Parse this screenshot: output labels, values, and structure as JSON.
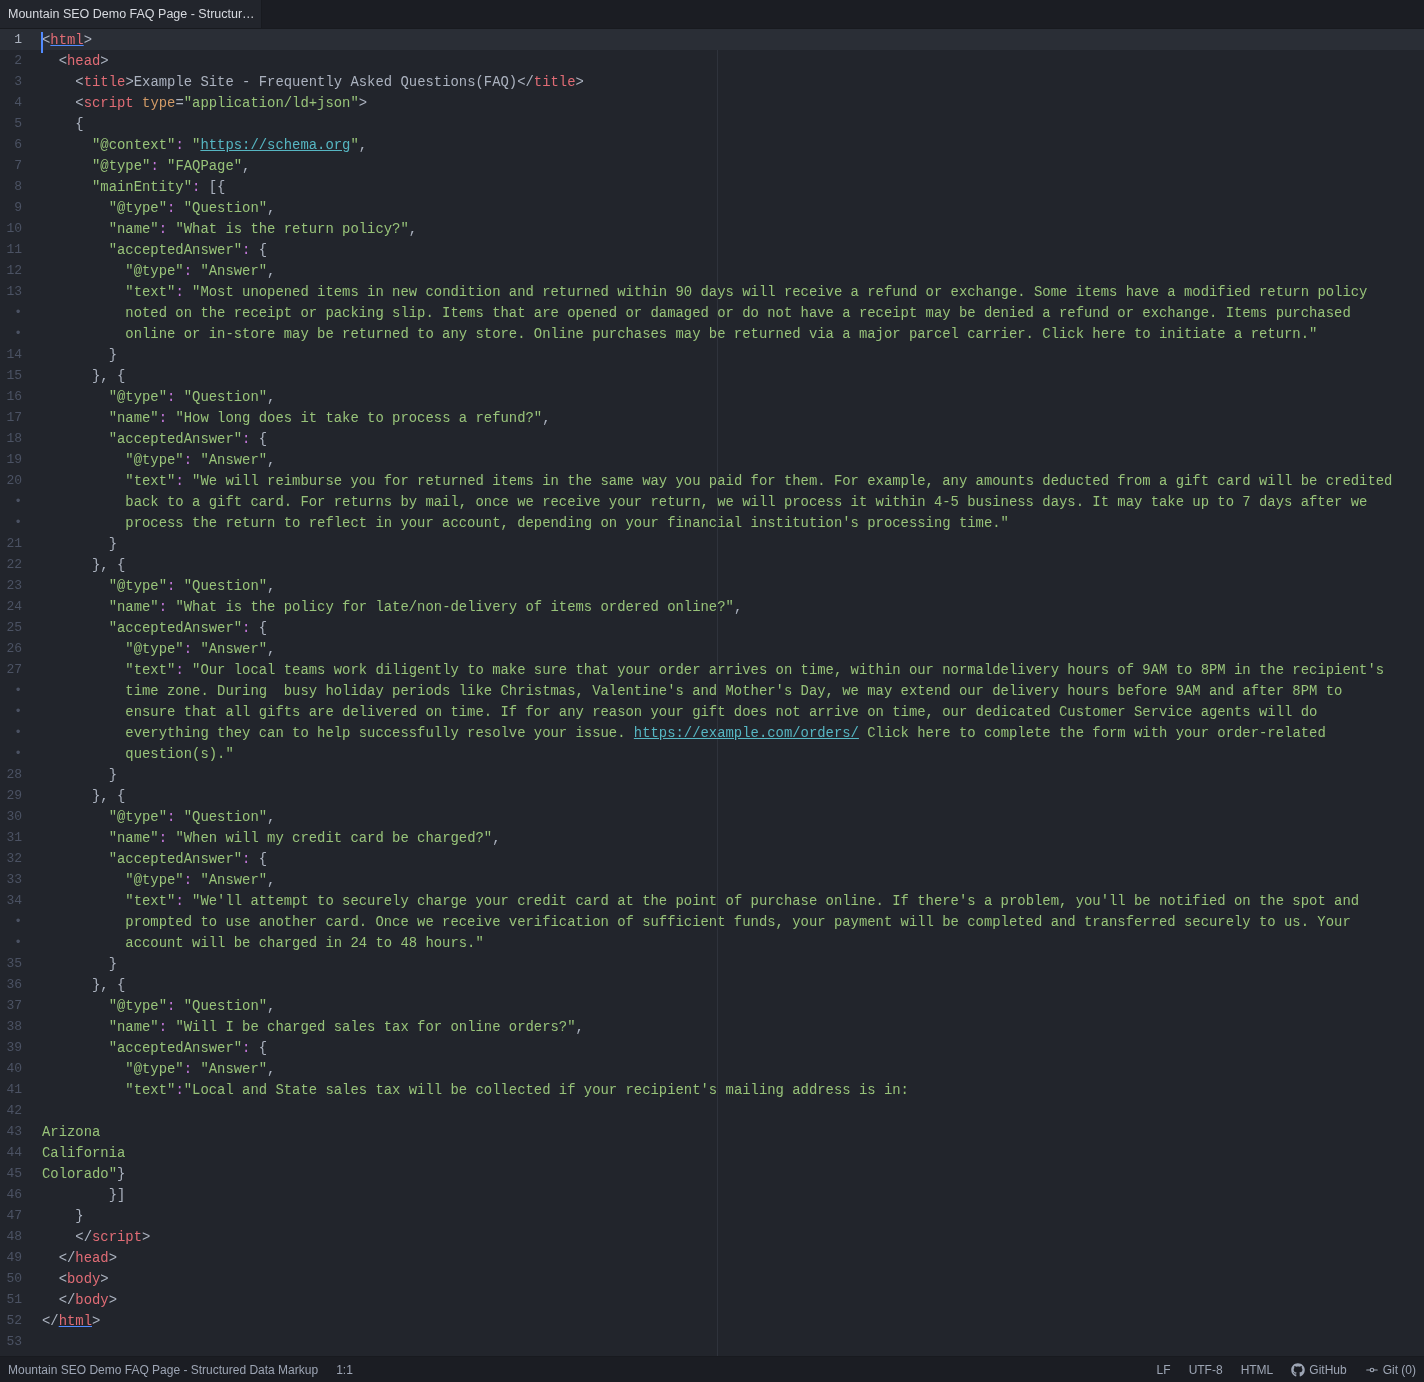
{
  "tabs": [
    {
      "label": "Mountain SEO Demo FAQ Page - Structur…",
      "selected": true
    }
  ],
  "editor": {
    "lines": [
      {
        "n": "1",
        "current": true,
        "segs": [
          {
            "kind": "p",
            "t": "<"
          },
          {
            "kind": "tm",
            "t": "html"
          },
          {
            "kind": "p",
            "t": ">"
          }
        ]
      },
      {
        "n": "2",
        "current": false,
        "segs": [
          {
            "kind": "p",
            "t": "  <"
          },
          {
            "kind": "t",
            "t": "head"
          },
          {
            "kind": "p",
            "t": ">"
          }
        ]
      },
      {
        "n": "3",
        "current": false,
        "segs": [
          {
            "kind": "p",
            "t": "    <"
          },
          {
            "kind": "t",
            "t": "title"
          },
          {
            "kind": "p",
            "t": ">"
          },
          {
            "kind": "x",
            "t": "Example Site - Frequently Asked Questions(FAQ)"
          },
          {
            "kind": "p",
            "t": "</"
          },
          {
            "kind": "t",
            "t": "title"
          },
          {
            "kind": "p",
            "t": ">"
          }
        ]
      },
      {
        "n": "4",
        "current": false,
        "segs": [
          {
            "kind": "p",
            "t": "    <"
          },
          {
            "kind": "t",
            "t": "script "
          },
          {
            "kind": "a",
            "t": "type"
          },
          {
            "kind": "p",
            "t": "="
          },
          {
            "kind": "s",
            "t": "\"application/ld+json\""
          },
          {
            "kind": "p",
            "t": ">"
          }
        ]
      },
      {
        "n": "5",
        "current": false,
        "segs": [
          {
            "kind": "p",
            "t": "    {"
          }
        ]
      },
      {
        "n": "6",
        "current": false,
        "segs": [
          {
            "kind": "s",
            "t": "      \"@context\""
          },
          {
            "kind": "c",
            "t": ":"
          },
          {
            "kind": "s",
            "t": " \""
          },
          {
            "kind": "l",
            "t": "https://schema.org"
          },
          {
            "kind": "s",
            "t": "\""
          },
          {
            "kind": "p",
            "t": ","
          }
        ]
      },
      {
        "n": "7",
        "current": false,
        "segs": [
          {
            "kind": "s",
            "t": "      \"@type\""
          },
          {
            "kind": "c",
            "t": ":"
          },
          {
            "kind": "s",
            "t": " \"FAQPage\""
          },
          {
            "kind": "p",
            "t": ","
          }
        ]
      },
      {
        "n": "8",
        "current": false,
        "segs": [
          {
            "kind": "s",
            "t": "      \"mainEntity\""
          },
          {
            "kind": "c",
            "t": ":"
          },
          {
            "kind": "p",
            "t": " [{"
          }
        ]
      },
      {
        "n": "9",
        "current": false,
        "segs": [
          {
            "kind": "s",
            "t": "        \"@type\""
          },
          {
            "kind": "c",
            "t": ":"
          },
          {
            "kind": "s",
            "t": " \"Question\""
          },
          {
            "kind": "p",
            "t": ","
          }
        ]
      },
      {
        "n": "10",
        "current": false,
        "segs": [
          {
            "kind": "s",
            "t": "        \"name\""
          },
          {
            "kind": "c",
            "t": ":"
          },
          {
            "kind": "s",
            "t": " \"What is the return policy?\""
          },
          {
            "kind": "p",
            "t": ","
          }
        ]
      },
      {
        "n": "11",
        "current": false,
        "segs": [
          {
            "kind": "s",
            "t": "        \"acceptedAnswer\""
          },
          {
            "kind": "c",
            "t": ":"
          },
          {
            "kind": "p",
            "t": " {"
          }
        ]
      },
      {
        "n": "12",
        "current": false,
        "segs": [
          {
            "kind": "s",
            "t": "          \"@type\""
          },
          {
            "kind": "c",
            "t": ":"
          },
          {
            "kind": "s",
            "t": " \"Answer\""
          },
          {
            "kind": "p",
            "t": ","
          }
        ]
      },
      {
        "n": "13",
        "current": false,
        "segs": [
          {
            "kind": "s",
            "t": "          \"text\""
          },
          {
            "kind": "c",
            "t": ":"
          },
          {
            "kind": "s",
            "t": " \"Most unopened items in new condition and returned within 90 days will receive a refund or exchange. Some items have a modified return policy"
          }
        ]
      },
      {
        "n": "•",
        "current": false,
        "segs": [
          {
            "kind": "s",
            "t": "          noted on the receipt or packing slip. Items that are opened or damaged or do not have a receipt may be denied a refund or exchange. Items purchased"
          }
        ]
      },
      {
        "n": "•",
        "current": false,
        "segs": [
          {
            "kind": "s",
            "t": "          online or in-store may be returned to any store. Online purchases may be returned via a major parcel carrier. Click here to initiate a return.\""
          }
        ]
      },
      {
        "n": "14",
        "current": false,
        "segs": [
          {
            "kind": "p",
            "t": "        }"
          }
        ]
      },
      {
        "n": "15",
        "current": false,
        "segs": [
          {
            "kind": "p",
            "t": "      }, {"
          }
        ]
      },
      {
        "n": "16",
        "current": false,
        "segs": [
          {
            "kind": "s",
            "t": "        \"@type\""
          },
          {
            "kind": "c",
            "t": ":"
          },
          {
            "kind": "s",
            "t": " \"Question\""
          },
          {
            "kind": "p",
            "t": ","
          }
        ]
      },
      {
        "n": "17",
        "current": false,
        "segs": [
          {
            "kind": "s",
            "t": "        \"name\""
          },
          {
            "kind": "c",
            "t": ":"
          },
          {
            "kind": "s",
            "t": " \"How long does it take to process a refund?\""
          },
          {
            "kind": "p",
            "t": ","
          }
        ]
      },
      {
        "n": "18",
        "current": false,
        "segs": [
          {
            "kind": "s",
            "t": "        \"acceptedAnswer\""
          },
          {
            "kind": "c",
            "t": ":"
          },
          {
            "kind": "p",
            "t": " {"
          }
        ]
      },
      {
        "n": "19",
        "current": false,
        "segs": [
          {
            "kind": "s",
            "t": "          \"@type\""
          },
          {
            "kind": "c",
            "t": ":"
          },
          {
            "kind": "s",
            "t": " \"Answer\""
          },
          {
            "kind": "p",
            "t": ","
          }
        ]
      },
      {
        "n": "20",
        "current": false,
        "segs": [
          {
            "kind": "s",
            "t": "          \"text\""
          },
          {
            "kind": "c",
            "t": ":"
          },
          {
            "kind": "s",
            "t": " \"We will reimburse you for returned items in the same way you paid for them. For example, any amounts deducted from a gift card will be credited"
          }
        ]
      },
      {
        "n": "•",
        "current": false,
        "segs": [
          {
            "kind": "s",
            "t": "          back to a gift card. For returns by mail, once we receive your return, we will process it within 4-5 business days. It may take up to 7 days after we"
          }
        ]
      },
      {
        "n": "•",
        "current": false,
        "segs": [
          {
            "kind": "s",
            "t": "          process the return to reflect in your account, depending on your financial institution's processing time.\""
          }
        ]
      },
      {
        "n": "21",
        "current": false,
        "segs": [
          {
            "kind": "p",
            "t": "        }"
          }
        ]
      },
      {
        "n": "22",
        "current": false,
        "segs": [
          {
            "kind": "p",
            "t": "      }, {"
          }
        ]
      },
      {
        "n": "23",
        "current": false,
        "segs": [
          {
            "kind": "s",
            "t": "        \"@type\""
          },
          {
            "kind": "c",
            "t": ":"
          },
          {
            "kind": "s",
            "t": " \"Question\""
          },
          {
            "kind": "p",
            "t": ","
          }
        ]
      },
      {
        "n": "24",
        "current": false,
        "segs": [
          {
            "kind": "s",
            "t": "        \"name\""
          },
          {
            "kind": "c",
            "t": ":"
          },
          {
            "kind": "s",
            "t": " \"What is the policy for late/non-delivery of items ordered online?\""
          },
          {
            "kind": "p",
            "t": ","
          }
        ]
      },
      {
        "n": "25",
        "current": false,
        "segs": [
          {
            "kind": "s",
            "t": "        \"acceptedAnswer\""
          },
          {
            "kind": "c",
            "t": ":"
          },
          {
            "kind": "p",
            "t": " {"
          }
        ]
      },
      {
        "n": "26",
        "current": false,
        "segs": [
          {
            "kind": "s",
            "t": "          \"@type\""
          },
          {
            "kind": "c",
            "t": ":"
          },
          {
            "kind": "s",
            "t": " \"Answer\""
          },
          {
            "kind": "p",
            "t": ","
          }
        ]
      },
      {
        "n": "27",
        "current": false,
        "segs": [
          {
            "kind": "s",
            "t": "          \"text\""
          },
          {
            "kind": "c",
            "t": ":"
          },
          {
            "kind": "s",
            "t": " \"Our local teams work diligently to make sure that your order arrives on time, within our normaldelivery hours of 9AM to 8PM in the recipient's"
          }
        ]
      },
      {
        "n": "•",
        "current": false,
        "segs": [
          {
            "kind": "s",
            "t": "          time zone. During  busy holiday periods like Christmas, Valentine's and Mother's Day, we may extend our delivery hours before 9AM and after 8PM to"
          }
        ]
      },
      {
        "n": "•",
        "current": false,
        "segs": [
          {
            "kind": "s",
            "t": "          ensure that all gifts are delivered on time. If for any reason your gift does not arrive on time, our dedicated Customer Service agents will do"
          }
        ]
      },
      {
        "n": "•",
        "current": false,
        "segs": [
          {
            "kind": "s",
            "t": "          everything they can to help successfully resolve your issue. "
          },
          {
            "kind": "l",
            "t": "https://example.com/orders/"
          },
          {
            "kind": "s",
            "t": " Click here to complete the form with your order-related"
          }
        ]
      },
      {
        "n": "•",
        "current": false,
        "segs": [
          {
            "kind": "s",
            "t": "          question(s).\""
          }
        ]
      },
      {
        "n": "28",
        "current": false,
        "segs": [
          {
            "kind": "p",
            "t": "        }"
          }
        ]
      },
      {
        "n": "29",
        "current": false,
        "segs": [
          {
            "kind": "p",
            "t": "      }, {"
          }
        ]
      },
      {
        "n": "30",
        "current": false,
        "segs": [
          {
            "kind": "s",
            "t": "        \"@type\""
          },
          {
            "kind": "c",
            "t": ":"
          },
          {
            "kind": "s",
            "t": " \"Question\""
          },
          {
            "kind": "p",
            "t": ","
          }
        ]
      },
      {
        "n": "31",
        "current": false,
        "segs": [
          {
            "kind": "s",
            "t": "        \"name\""
          },
          {
            "kind": "c",
            "t": ":"
          },
          {
            "kind": "s",
            "t": " \"When will my credit card be charged?\""
          },
          {
            "kind": "p",
            "t": ","
          }
        ]
      },
      {
        "n": "32",
        "current": false,
        "segs": [
          {
            "kind": "s",
            "t": "        \"acceptedAnswer\""
          },
          {
            "kind": "c",
            "t": ":"
          },
          {
            "kind": "p",
            "t": " {"
          }
        ]
      },
      {
        "n": "33",
        "current": false,
        "segs": [
          {
            "kind": "s",
            "t": "          \"@type\""
          },
          {
            "kind": "c",
            "t": ":"
          },
          {
            "kind": "s",
            "t": " \"Answer\""
          },
          {
            "kind": "p",
            "t": ","
          }
        ]
      },
      {
        "n": "34",
        "current": false,
        "segs": [
          {
            "kind": "s",
            "t": "          \"text\""
          },
          {
            "kind": "c",
            "t": ":"
          },
          {
            "kind": "s",
            "t": " \"We'll attempt to securely charge your credit card at the point of purchase online. If there's a problem, you'll be notified on the spot and"
          }
        ]
      },
      {
        "n": "•",
        "current": false,
        "segs": [
          {
            "kind": "s",
            "t": "          prompted to use another card. Once we receive verification of sufficient funds, your payment will be completed and transferred securely to us. Your"
          }
        ]
      },
      {
        "n": "•",
        "current": false,
        "segs": [
          {
            "kind": "s",
            "t": "          account will be charged in 24 to 48 hours.\""
          }
        ]
      },
      {
        "n": "35",
        "current": false,
        "segs": [
          {
            "kind": "p",
            "t": "        }"
          }
        ]
      },
      {
        "n": "36",
        "current": false,
        "segs": [
          {
            "kind": "p",
            "t": "      }, {"
          }
        ]
      },
      {
        "n": "37",
        "current": false,
        "segs": [
          {
            "kind": "s",
            "t": "        \"@type\""
          },
          {
            "kind": "c",
            "t": ":"
          },
          {
            "kind": "s",
            "t": " \"Question\""
          },
          {
            "kind": "p",
            "t": ","
          }
        ]
      },
      {
        "n": "38",
        "current": false,
        "segs": [
          {
            "kind": "s",
            "t": "        \"name\""
          },
          {
            "kind": "c",
            "t": ":"
          },
          {
            "kind": "s",
            "t": " \"Will I be charged sales tax for online orders?\""
          },
          {
            "kind": "p",
            "t": ","
          }
        ]
      },
      {
        "n": "39",
        "current": false,
        "segs": [
          {
            "kind": "s",
            "t": "        \"acceptedAnswer\""
          },
          {
            "kind": "c",
            "t": ":"
          },
          {
            "kind": "p",
            "t": " {"
          }
        ]
      },
      {
        "n": "40",
        "current": false,
        "segs": [
          {
            "kind": "s",
            "t": "          \"@type\""
          },
          {
            "kind": "c",
            "t": ":"
          },
          {
            "kind": "s",
            "t": " \"Answer\""
          },
          {
            "kind": "p",
            "t": ","
          }
        ]
      },
      {
        "n": "41",
        "current": false,
        "segs": [
          {
            "kind": "s",
            "t": "          \"text\""
          },
          {
            "kind": "c",
            "t": ":"
          },
          {
            "kind": "s",
            "t": "\"Local and State sales tax will be collected if your recipient's mailing address is in:"
          }
        ]
      },
      {
        "n": "42",
        "current": false
      },
      {
        "n": "43",
        "current": false,
        "segs": [
          {
            "kind": "s",
            "t": "Arizona"
          }
        ]
      },
      {
        "n": "44",
        "current": false,
        "segs": [
          {
            "kind": "s",
            "t": "California"
          }
        ]
      },
      {
        "n": "45",
        "current": false,
        "segs": [
          {
            "kind": "s",
            "t": "Colorado\""
          },
          {
            "kind": "p",
            "t": "}"
          }
        ]
      },
      {
        "n": "46",
        "current": false,
        "segs": [
          {
            "kind": "p",
            "t": "        }]"
          }
        ]
      },
      {
        "n": "47",
        "current": false,
        "segs": [
          {
            "kind": "p",
            "t": "    }"
          }
        ]
      },
      {
        "n": "48",
        "current": false,
        "segs": [
          {
            "kind": "p",
            "t": "    </"
          },
          {
            "kind": "t",
            "t": "script"
          },
          {
            "kind": "p",
            "t": ">"
          }
        ]
      },
      {
        "n": "49",
        "current": false,
        "segs": [
          {
            "kind": "p",
            "t": "  </"
          },
          {
            "kind": "t",
            "t": "head"
          },
          {
            "kind": "p",
            "t": ">"
          }
        ]
      },
      {
        "n": "50",
        "current": false,
        "segs": [
          {
            "kind": "p",
            "t": "  <"
          },
          {
            "kind": "t",
            "t": "body"
          },
          {
            "kind": "p",
            "t": ">"
          }
        ]
      },
      {
        "n": "51",
        "current": false,
        "segs": [
          {
            "kind": "p",
            "t": "  </"
          },
          {
            "kind": "t",
            "t": "body"
          },
          {
            "kind": "p",
            "t": ">"
          }
        ]
      },
      {
        "n": "52",
        "current": false,
        "segs": [
          {
            "kind": "p",
            "t": "</"
          },
          {
            "kind": "tm",
            "t": "html"
          },
          {
            "kind": "p",
            "t": ">"
          }
        ]
      },
      {
        "n": "53",
        "current": false
      }
    ]
  },
  "status_bar": {
    "file": "Mountain SEO Demo FAQ Page - Structured Data Markup",
    "position": "1:1",
    "items": [
      {
        "kind": "text",
        "label": "LF"
      },
      {
        "kind": "text",
        "label": "UTF-8"
      },
      {
        "kind": "text",
        "label": "HTML"
      },
      {
        "kind": "github",
        "label": "GitHub"
      },
      {
        "kind": "git",
        "label": "Git (0)"
      }
    ]
  }
}
